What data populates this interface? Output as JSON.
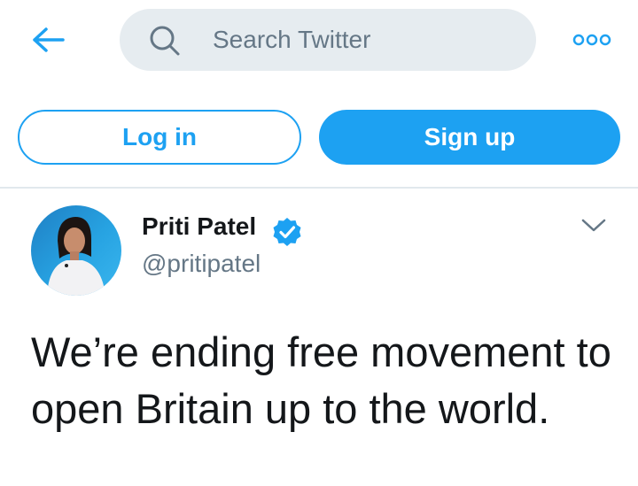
{
  "header": {
    "back_icon": "arrow-left-icon",
    "search": {
      "icon": "search-icon",
      "placeholder": "Search Twitter",
      "value": ""
    },
    "more_icon": "more-options-icon"
  },
  "auth": {
    "login_label": "Log in",
    "signup_label": "Sign up"
  },
  "tweet": {
    "author": {
      "name": "Priti Patel",
      "handle": "@pritipatel",
      "verified": true,
      "avatar": "avatar-photo"
    },
    "menu_icon": "chevron-down-icon",
    "text": "We’re ending free movement to open Britain up to the world."
  },
  "colors": {
    "accent": "#1da1f2",
    "search_bg": "#e6ecf0",
    "text_primary": "#14171a",
    "text_secondary": "#657786",
    "divider": "#e1e8ed"
  }
}
